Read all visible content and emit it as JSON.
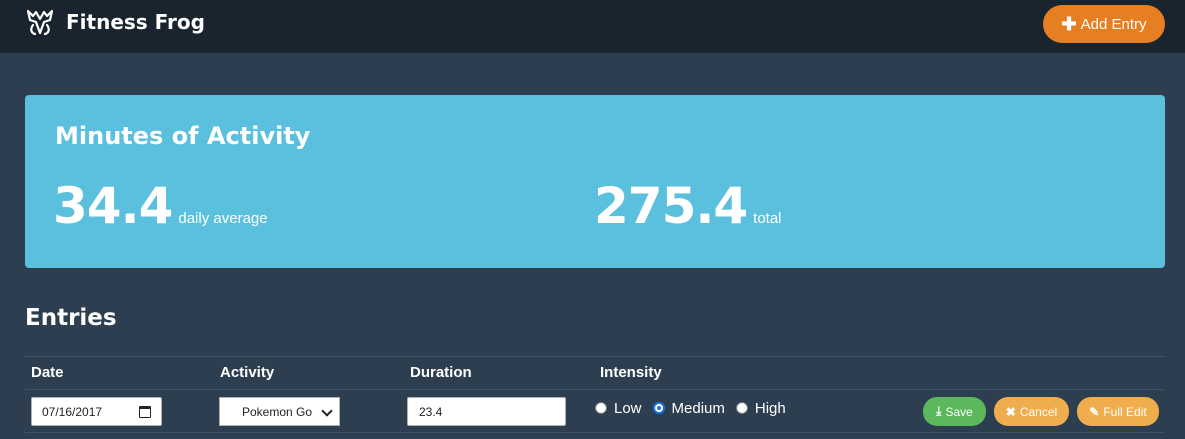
{
  "app": {
    "title": "Fitness Frog",
    "add_entry_label": "Add Entry",
    "add_entry_icon": "plus-icon",
    "logo_icon": "frog-logo-icon"
  },
  "stats": {
    "title": "Minutes of Activity",
    "daily_average_value": "34.4",
    "daily_average_label": "daily average",
    "total_value": "275.4",
    "total_label": "total"
  },
  "entries": {
    "title": "Entries",
    "columns": [
      "Date",
      "Activity",
      "Duration",
      "Intensity"
    ],
    "row": {
      "date": "07/16/2017",
      "activity": "Pokemon Go",
      "duration": "23.4",
      "intensity_options": [
        "Low",
        "Medium",
        "High"
      ],
      "intensity_selected": "Medium"
    },
    "actions": {
      "save": "Save",
      "cancel": "Cancel",
      "full_edit": "Full Edit"
    }
  },
  "colors": {
    "navbar": "#1a242f",
    "background": "#2c3e50",
    "stats_panel": "#5bc0de",
    "add_entry": "#e67e22",
    "save": "#5cb85c",
    "warning": "#f0ad4e"
  }
}
